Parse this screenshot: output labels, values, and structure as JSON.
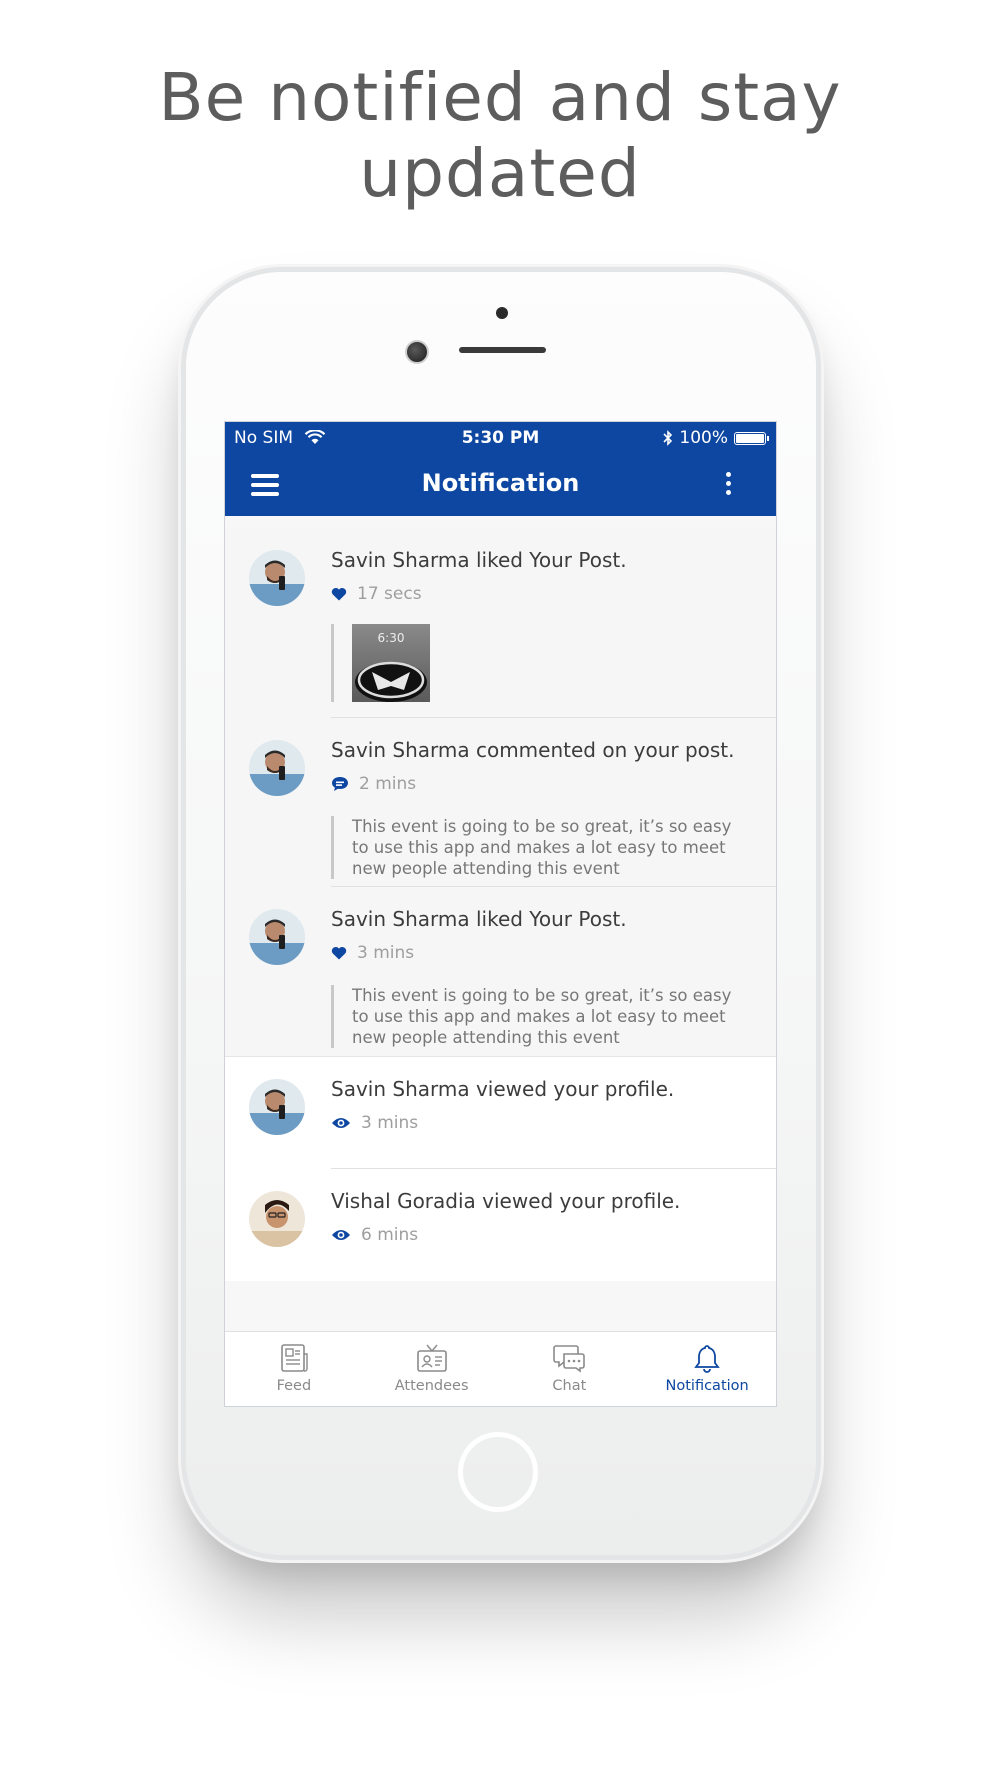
{
  "headline": {
    "line1": "Be notified and stay",
    "line2": "updated"
  },
  "status_bar": {
    "carrier": "No SIM",
    "time": "5:30 PM",
    "battery": "100%"
  },
  "app_bar": {
    "title": "Notification"
  },
  "notifications": [
    {
      "text": "Savin Sharma liked Your Post.",
      "icon": "heart-icon",
      "time": "17 secs",
      "attachment": "image-thumbnail"
    },
    {
      "text": "Savin Sharma commented on your post.",
      "icon": "comment-icon",
      "time": "2 mins",
      "quote": "This event is going to be so great, it’s so easy to use this app and makes a lot easy to meet new people attending this event"
    },
    {
      "text": "Savin Sharma liked Your Post.",
      "icon": "heart-icon",
      "time": "3 mins",
      "quote": "This event is going to be so great, it’s so easy to use this app and makes a lot easy to meet new people attending this event"
    },
    {
      "text": "Savin Sharma viewed your profile.",
      "icon": "eye-icon",
      "time": "3 mins"
    },
    {
      "text": "Vishal Goradia viewed your profile.",
      "icon": "eye-icon",
      "time": "6 mins"
    }
  ],
  "thumbnail": {
    "time_text": "6:30"
  },
  "tab_bar": {
    "tabs": [
      {
        "label": "Feed",
        "icon": "feed-icon"
      },
      {
        "label": "Attendees",
        "icon": "attendees-icon"
      },
      {
        "label": "Chat",
        "icon": "chat-icon"
      },
      {
        "label": "Notification",
        "icon": "bell-icon",
        "active": true
      }
    ]
  },
  "colors": {
    "primary": "#0d47a1",
    "background": "#f7f7f7",
    "text": "#3c3c3c",
    "muted": "#9e9e9e"
  }
}
